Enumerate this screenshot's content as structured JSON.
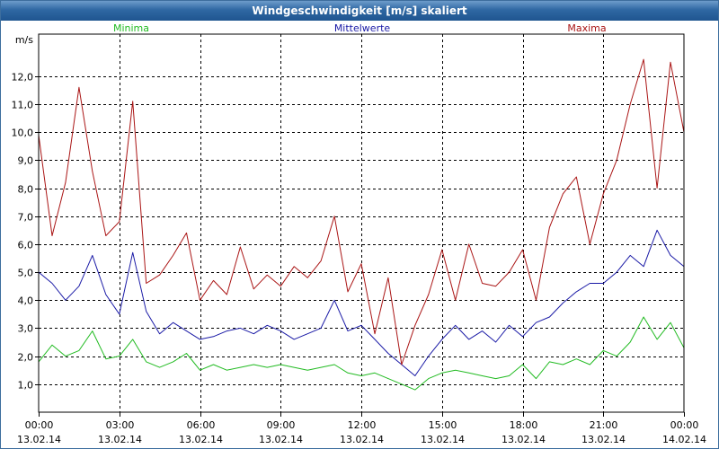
{
  "window": {
    "title": "Windgeschwindigkeit [m/s] skaliert"
  },
  "chart_data": {
    "type": "line",
    "title": "Windgeschwindigkeit [m/s] skaliert",
    "ylabel": "m/s",
    "ylim": [
      0.0,
      13.5
    ],
    "yticks": [
      {
        "value": 1.0,
        "label": "1,0"
      },
      {
        "value": 2.0,
        "label": "2,0"
      },
      {
        "value": 3.0,
        "label": "3,0"
      },
      {
        "value": 4.0,
        "label": "4,0"
      },
      {
        "value": 5.0,
        "label": "5,0"
      },
      {
        "value": 6.0,
        "label": "6,0"
      },
      {
        "value": 7.0,
        "label": "7,0"
      },
      {
        "value": 8.0,
        "label": "8,0"
      },
      {
        "value": 9.0,
        "label": "9,0"
      },
      {
        "value": 10.0,
        "label": "10,0"
      },
      {
        "value": 11.0,
        "label": "11,0"
      },
      {
        "value": 12.0,
        "label": "12,0"
      }
    ],
    "xlim_hours": [
      0,
      24
    ],
    "xticks": [
      {
        "hour": 0,
        "time": "00:00",
        "date": "13.02.14"
      },
      {
        "hour": 3,
        "time": "03:00",
        "date": "13.02.14"
      },
      {
        "hour": 6,
        "time": "06:00",
        "date": "13.02.14"
      },
      {
        "hour": 9,
        "time": "09:00",
        "date": "13.02.14"
      },
      {
        "hour": 12,
        "time": "12:00",
        "date": "13.02.14"
      },
      {
        "hour": 15,
        "time": "15:00",
        "date": "13.02.14"
      },
      {
        "hour": 18,
        "time": "18:00",
        "date": "13.02.14"
      },
      {
        "hour": 21,
        "time": "21:00",
        "date": "13.02.14"
      },
      {
        "hour": 24,
        "time": "00:00",
        "date": "14.02.14"
      }
    ],
    "grid": true,
    "legend_placement": "top",
    "series": [
      {
        "name": "Minima",
        "color": "#22bb22",
        "x": [
          0,
          0.5,
          1,
          1.5,
          2,
          2.5,
          3,
          3.5,
          4,
          4.5,
          5,
          5.5,
          6,
          6.5,
          7,
          7.5,
          8,
          8.5,
          9,
          9.5,
          10,
          10.5,
          11,
          11.5,
          12,
          12.5,
          13,
          13.5,
          14,
          14.5,
          15,
          15.5,
          16,
          16.5,
          17,
          17.5,
          18,
          18.5,
          19,
          19.5,
          20,
          20.5,
          21,
          21.5,
          22,
          22.5,
          23,
          23.5,
          24
        ],
        "values": [
          1.8,
          2.4,
          2.0,
          2.2,
          2.9,
          1.9,
          2.0,
          2.6,
          1.8,
          1.6,
          1.8,
          2.1,
          1.5,
          1.7,
          1.5,
          1.6,
          1.7,
          1.6,
          1.7,
          1.6,
          1.5,
          1.6,
          1.7,
          1.4,
          1.3,
          1.4,
          1.2,
          1.0,
          0.8,
          1.2,
          1.4,
          1.5,
          1.4,
          1.3,
          1.2,
          1.3,
          1.7,
          1.2,
          1.8,
          1.7,
          1.9,
          1.7,
          2.2,
          2.0,
          2.5,
          3.4,
          2.6,
          3.2,
          2.3
        ]
      },
      {
        "name": "Mittelwerte",
        "color": "#1a1aa6",
        "x": [
          0,
          0.5,
          1,
          1.5,
          2,
          2.5,
          3,
          3.5,
          4,
          4.5,
          5,
          5.5,
          6,
          6.5,
          7,
          7.5,
          8,
          8.5,
          9,
          9.5,
          10,
          10.5,
          11,
          11.5,
          12,
          12.5,
          13,
          13.5,
          14,
          14.5,
          15,
          15.5,
          16,
          16.5,
          17,
          17.5,
          18,
          18.5,
          19,
          19.5,
          20,
          20.5,
          21,
          21.5,
          22,
          22.5,
          23,
          23.5,
          24
        ],
        "values": [
          5.0,
          4.6,
          4.0,
          4.5,
          5.6,
          4.2,
          3.5,
          5.7,
          3.6,
          2.8,
          3.2,
          2.9,
          2.6,
          2.7,
          2.9,
          3.0,
          2.8,
          3.1,
          2.9,
          2.6,
          2.8,
          3.0,
          4.0,
          2.9,
          3.1,
          2.6,
          2.1,
          1.7,
          1.3,
          2.0,
          2.6,
          3.1,
          2.6,
          2.9,
          2.5,
          3.1,
          2.7,
          3.2,
          3.4,
          3.9,
          4.3,
          4.6,
          4.6,
          5.0,
          5.6,
          5.2,
          6.5,
          5.6,
          5.2
        ]
      },
      {
        "name": "Maxima",
        "color": "#aa1515",
        "x": [
          0,
          0.5,
          1,
          1.5,
          2,
          2.5,
          3,
          3.5,
          4,
          4.5,
          5,
          5.5,
          6,
          6.5,
          7,
          7.5,
          8,
          8.5,
          9,
          9.5,
          10,
          10.5,
          11,
          11.5,
          12,
          12.5,
          13,
          13.5,
          14,
          14.5,
          15,
          15.5,
          16,
          16.5,
          17,
          17.5,
          18,
          18.5,
          19,
          19.5,
          20,
          20.5,
          21,
          21.5,
          22,
          22.5,
          23,
          23.5,
          24
        ],
        "values": [
          9.9,
          6.3,
          8.2,
          11.6,
          8.6,
          6.3,
          6.8,
          11.1,
          4.6,
          4.9,
          5.6,
          6.4,
          4.0,
          4.7,
          4.2,
          5.9,
          4.4,
          4.9,
          4.5,
          5.2,
          4.8,
          5.4,
          7.0,
          4.3,
          5.3,
          2.8,
          4.8,
          1.7,
          3.1,
          4.2,
          5.8,
          4.0,
          6.0,
          4.6,
          4.5,
          5.0,
          5.8,
          4.0,
          6.6,
          7.8,
          8.4,
          6.0,
          7.8,
          9.0,
          11.0,
          12.6,
          8.0,
          12.5,
          10.0
        ]
      }
    ]
  }
}
